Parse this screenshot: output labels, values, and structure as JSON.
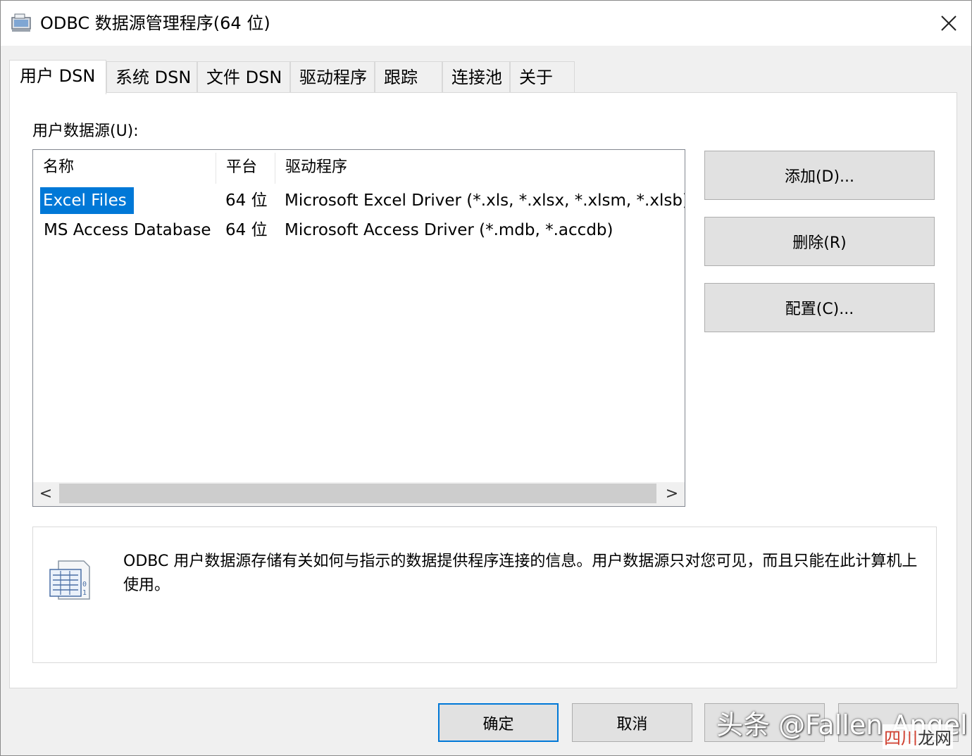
{
  "window": {
    "title": "ODBC 数据源管理程序(64 位)",
    "close_symbol": "✕"
  },
  "tabs": [
    {
      "label": "用户 DSN",
      "active": true
    },
    {
      "label": "系统 DSN",
      "active": false
    },
    {
      "label": "文件 DSN",
      "active": false
    },
    {
      "label": "驱动程序",
      "active": false
    },
    {
      "label": "跟踪",
      "active": false
    },
    {
      "label": "连接池",
      "active": false
    },
    {
      "label": "关于",
      "active": false
    }
  ],
  "user_dsn": {
    "section_label": "用户数据源(U):",
    "columns": [
      "名称",
      "平台",
      "驱动程序"
    ],
    "rows": [
      {
        "name": "Excel Files",
        "platform": "64 位",
        "driver": "Microsoft Excel Driver (*.xls, *.xlsx, *.xlsm, *.xlsb)",
        "selected": true
      },
      {
        "name": "MS Access Database",
        "platform": "64 位",
        "driver": "Microsoft Access Driver (*.mdb, *.accdb)",
        "selected": false
      }
    ],
    "scroll_left": "<",
    "scroll_right": ">",
    "buttons": {
      "add": "添加(D)...",
      "remove": "删除(R)",
      "configure": "配置(C)..."
    },
    "info_text": "ODBC 用户数据源存储有关如何与指示的数据提供程序连接的信息。用户数据源只对您可见，而且只能在此计算机上使用。"
  },
  "footer": {
    "ok": "确定",
    "cancel": "取消"
  },
  "watermark": {
    "text": "头条 @Fallen Angel",
    "site_a": "四川",
    "site_b": "龙网"
  },
  "colors": {
    "selection": "#0078d7",
    "button_face": "#e1e1e1",
    "window_bg": "#f0f0f0"
  }
}
